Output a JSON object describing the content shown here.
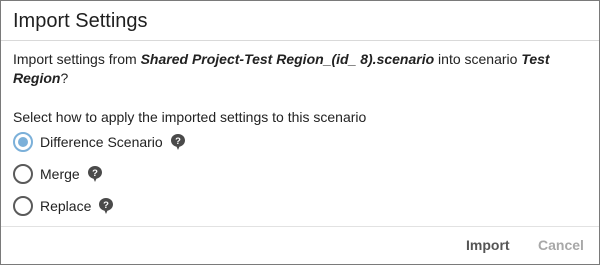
{
  "dialog": {
    "title": "Import Settings"
  },
  "message": {
    "prefix": "Import settings from ",
    "source": "Shared Project-Test Region_(id_ 8).scenario",
    "middle": " into scenario ",
    "target": "Test Region",
    "suffix": "?"
  },
  "instruction": "Select how to apply the imported settings to this scenario",
  "options": [
    {
      "label": "Difference Scenario",
      "selected": true,
      "icon": "help-icon"
    },
    {
      "label": "Merge",
      "selected": false,
      "icon": "help-icon"
    },
    {
      "label": "Replace",
      "selected": false,
      "icon": "help-icon"
    }
  ],
  "footer": {
    "import_label": "Import",
    "cancel_label": "Cancel"
  },
  "colors": {
    "radio_selected": "#7bb0d9",
    "border": "#7a7a7a",
    "cancel_disabled": "#a8a8a8"
  }
}
